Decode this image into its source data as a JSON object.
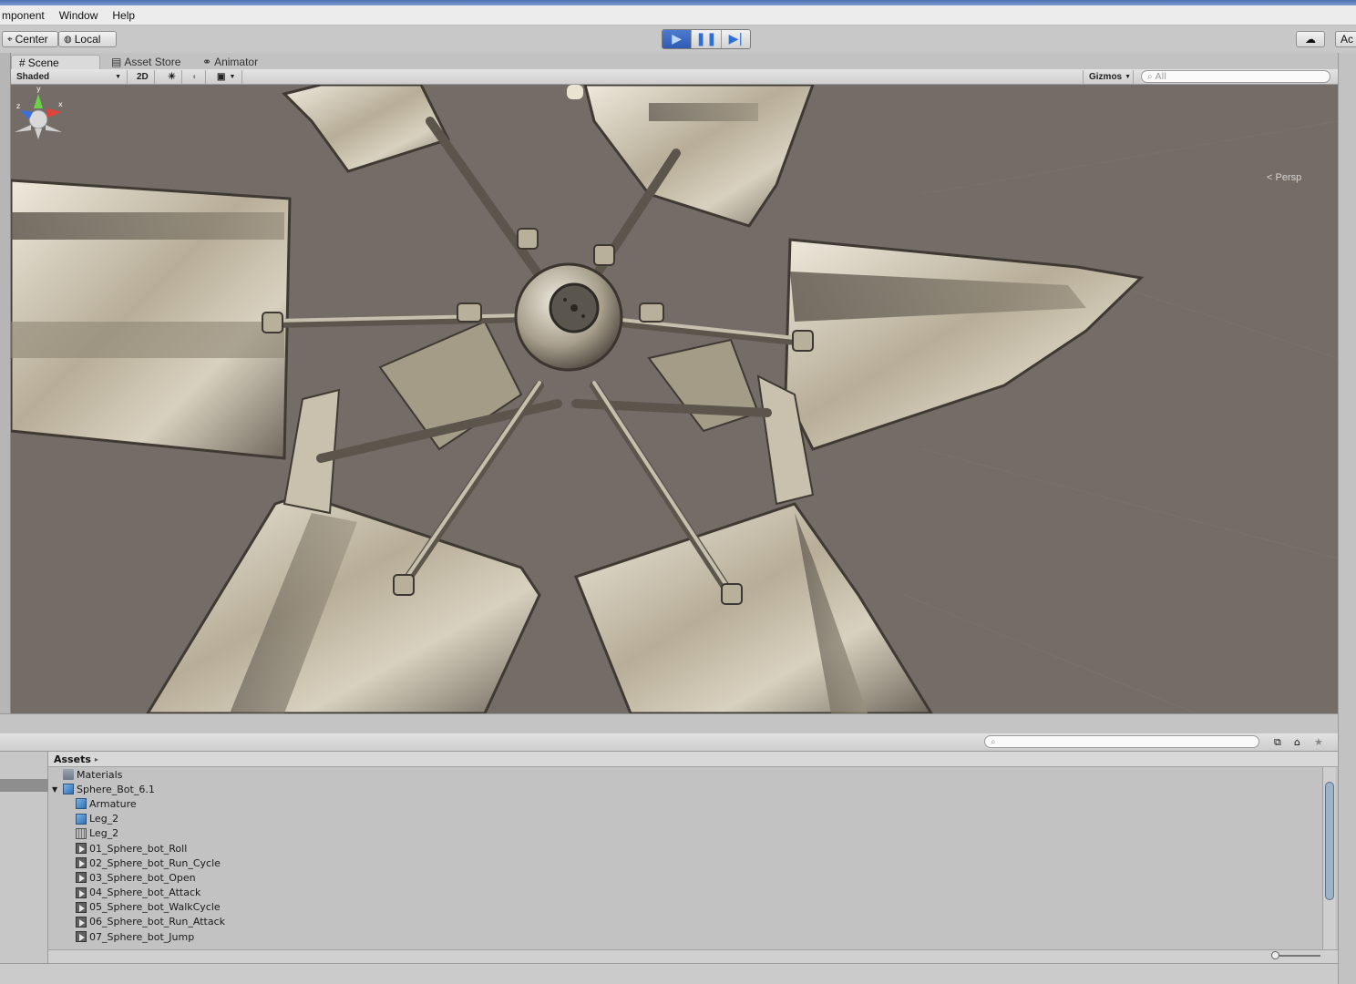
{
  "menu": {
    "component": "mponent",
    "window": "Window",
    "help": "Help"
  },
  "toolbar": {
    "center_label": "Center",
    "local_label": "Local",
    "right_partial": "Ac"
  },
  "tabs": [
    {
      "label": "Scene"
    },
    {
      "label": "Asset Store"
    },
    {
      "label": "Animator"
    }
  ],
  "scene_bar": {
    "draw_mode": "Shaded",
    "mode_2d": "2D",
    "gizmos": "Gizmos",
    "search_placeholder": "All"
  },
  "viewport": {
    "persp_label": "Persp",
    "axis_x": "x",
    "axis_y": "y",
    "axis_z": "z"
  },
  "project": {
    "breadcrumb": "Assets",
    "items": [
      {
        "label": "Materials",
        "icon": "folder-icon",
        "indent": 1
      },
      {
        "label": "Sphere_Bot_6.1",
        "icon": "prefab-icon",
        "indent": 0,
        "expanded": true
      },
      {
        "label": "Armature",
        "icon": "prefab-icon",
        "indent": 2
      },
      {
        "label": "Leg_2",
        "icon": "prefab-icon",
        "indent": 2
      },
      {
        "label": "Leg_2",
        "icon": "mesh-icon",
        "indent": 2
      },
      {
        "label": "01_Sphere_bot_Roll",
        "icon": "animation-icon",
        "indent": 2
      },
      {
        "label": "02_Sphere_bot_Run_Cycle",
        "icon": "animation-icon",
        "indent": 2
      },
      {
        "label": "03_Sphere_bot_Open",
        "icon": "animation-icon",
        "indent": 2
      },
      {
        "label": "04_Sphere_bot_Attack",
        "icon": "animation-icon",
        "indent": 2
      },
      {
        "label": "05_Sphere_bot_WalkCycle",
        "icon": "animation-icon",
        "indent": 2
      },
      {
        "label": "06_Sphere_bot_Run_Attack",
        "icon": "animation-icon",
        "indent": 2
      },
      {
        "label": "07_Sphere_bot_Jump",
        "icon": "animation-icon",
        "indent": 2
      }
    ]
  }
}
